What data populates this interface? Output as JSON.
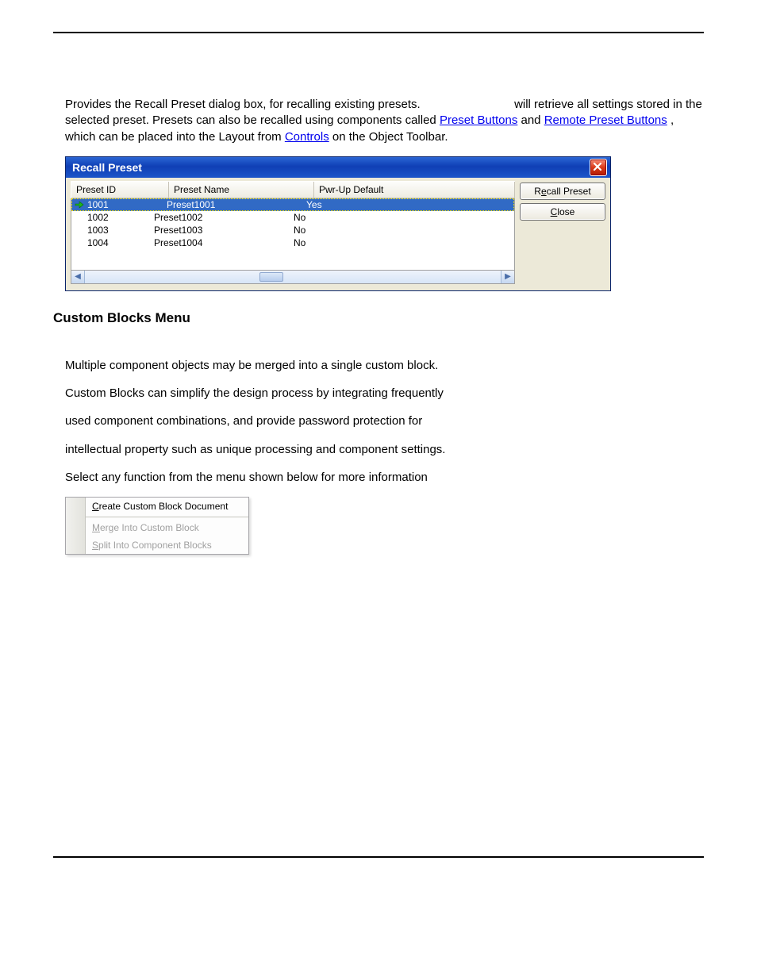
{
  "intro": {
    "pre": "Provides the Recall Preset dialog box, for recalling existing presets. ",
    "post": " will retrieve all settings stored in the selected preset. Presets can also be recalled using components called ",
    "link1": "Preset Buttons",
    "mid1": " and ",
    "link2": "Remote Preset Buttons",
    "mid2": ", which can be placed into the Layout from ",
    "link3": "Controls",
    "end": " on the Object Toolbar."
  },
  "dialog": {
    "title": "Recall Preset",
    "columns": {
      "id": "Preset ID",
      "name": "Preset Name",
      "def": "Pwr-Up Default"
    },
    "rows": [
      {
        "id": "1001",
        "name": "Preset1001",
        "def": "Yes",
        "selected": true
      },
      {
        "id": "1002",
        "name": "Preset1002",
        "def": "No",
        "selected": false
      },
      {
        "id": "1003",
        "name": "Preset1003",
        "def": "No",
        "selected": false
      },
      {
        "id": "1004",
        "name": "Preset1004",
        "def": "No",
        "selected": false
      }
    ],
    "buttons": {
      "recall_pre": "R",
      "recall_ul": "e",
      "recall_post": "call Preset",
      "close_pre": "",
      "close_ul": "C",
      "close_post": "lose"
    }
  },
  "section_heading": "Custom Blocks Menu",
  "paragraphs": [
    "Multiple component objects may be merged into a single custom block.",
    "Custom Blocks can simplify the design process by integrating frequently",
    "used component combinations, and provide password protection for",
    "intellectual property such as unique processing and component settings.",
    "Select any function from the menu shown below for more information"
  ],
  "menu": {
    "item1_ul": "C",
    "item1_rest": "reate Custom Block Document",
    "item2_ul": "M",
    "item2_rest": "erge Into Custom Block",
    "item3_ul": "S",
    "item3_rest": "plit Into Component Blocks"
  }
}
